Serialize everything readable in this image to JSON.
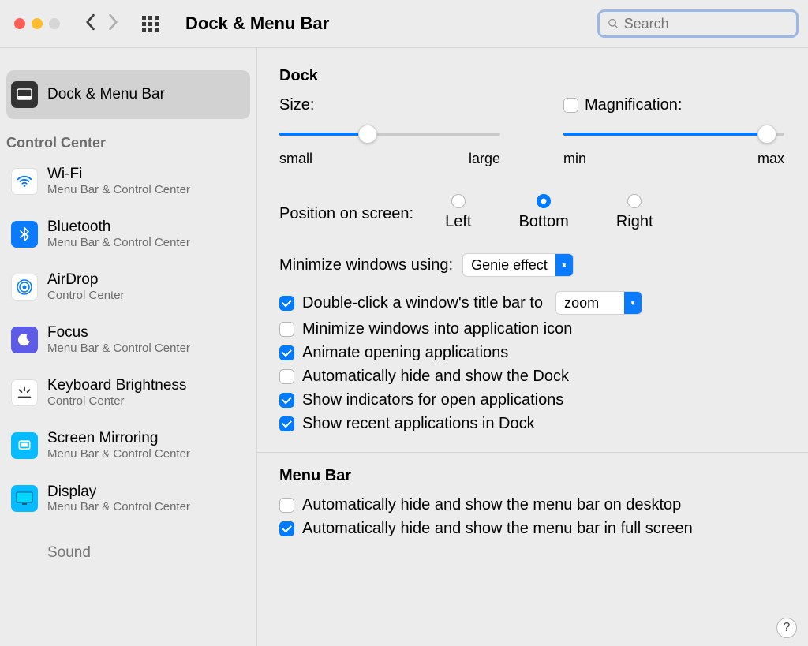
{
  "toolbar": {
    "title": "Dock & Menu Bar",
    "search_placeholder": "Search"
  },
  "sidebar": {
    "selected": {
      "label": "Dock & Menu Bar"
    },
    "section_header": "Control Center",
    "items": [
      {
        "label": "Wi-Fi",
        "sub": "Menu Bar & Control Center"
      },
      {
        "label": "Bluetooth",
        "sub": "Menu Bar & Control Center"
      },
      {
        "label": "AirDrop",
        "sub": "Control Center"
      },
      {
        "label": "Focus",
        "sub": "Menu Bar & Control Center"
      },
      {
        "label": "Keyboard Brightness",
        "sub": "Control Center"
      },
      {
        "label": "Screen Mirroring",
        "sub": "Menu Bar & Control Center"
      },
      {
        "label": "Display",
        "sub": "Menu Bar & Control Center"
      },
      {
        "label": "Sound",
        "sub": ""
      }
    ]
  },
  "dock": {
    "section_title": "Dock",
    "size_label": "Size:",
    "size_min": "small",
    "size_max": "large",
    "size_value_pct": 40,
    "magnification_label": "Magnification:",
    "magnification_checked": false,
    "mag_min": "min",
    "mag_max": "max",
    "mag_value_pct": 92,
    "position_label": "Position on screen:",
    "positions": [
      "Left",
      "Bottom",
      "Right"
    ],
    "position_selected_index": 1,
    "minimize_label": "Minimize windows using:",
    "minimize_value": "Genie effect",
    "doubleclick_label": "Double-click a window's title bar to",
    "doubleclick_checked": true,
    "doubleclick_value": "zoom",
    "checks": [
      {
        "label": "Minimize windows into application icon",
        "checked": false
      },
      {
        "label": "Animate opening applications",
        "checked": true
      },
      {
        "label": "Automatically hide and show the Dock",
        "checked": false
      },
      {
        "label": "Show indicators for open applications",
        "checked": true
      },
      {
        "label": "Show recent applications in Dock",
        "checked": true
      }
    ]
  },
  "menubar": {
    "section_title": "Menu Bar",
    "checks": [
      {
        "label": "Automatically hide and show the menu bar on desktop",
        "checked": false
      },
      {
        "label": "Automatically hide and show the menu bar in full screen",
        "checked": true
      }
    ]
  },
  "help_label": "?"
}
